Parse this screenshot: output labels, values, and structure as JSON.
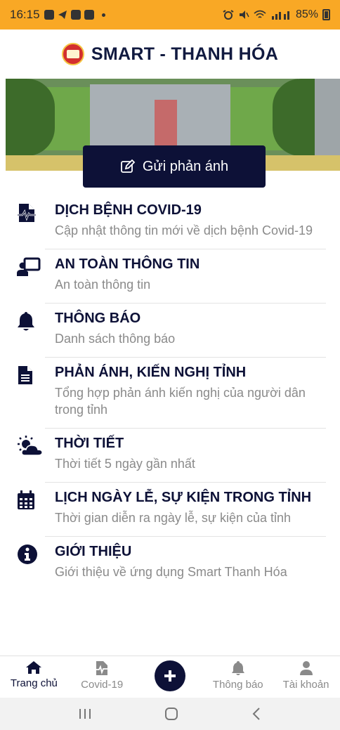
{
  "status_bar": {
    "time": "16:15",
    "battery": "85%"
  },
  "header": {
    "title": "SMART - THANH HÓA"
  },
  "report_button": {
    "label": "Gửi phản ánh"
  },
  "menu": {
    "items": [
      {
        "title": "DỊCH BỆNH COVID-19",
        "subtitle": "Cập nhật thông tin mới về dịch bệnh Covid-19",
        "icon": "covid-report-icon"
      },
      {
        "title": "AN TOÀN THÔNG TIN",
        "subtitle": "An toàn thông tin",
        "icon": "presentation-user-icon"
      },
      {
        "title": "THÔNG BÁO",
        "subtitle": "Danh sách thông báo",
        "icon": "bell-icon"
      },
      {
        "title": "PHẢN ÁNH, KIẾN NGHỊ TỈNH",
        "subtitle": "Tổng hợp phản ánh kiến nghị của người dân trong tỉnh",
        "icon": "document-icon"
      },
      {
        "title": "THỜI TIẾT",
        "subtitle": "Thời tiết 5 ngày gần nhất",
        "icon": "weather-icon"
      },
      {
        "title": "LỊCH NGÀY LỄ, SỰ KIỆN TRONG TỈNH",
        "subtitle": "Thời gian diễn ra ngày lễ, sự kiện của tỉnh",
        "icon": "calendar-icon"
      },
      {
        "title": "GIỚI THIỆU",
        "subtitle": "Giới thiệu về ứng dụng Smart Thanh Hóa",
        "icon": "info-icon"
      }
    ]
  },
  "bottom_nav": {
    "home": "Trang chủ",
    "covid": "Covid-19",
    "notifications": "Thông báo",
    "account": "Tài khoản"
  },
  "colors": {
    "status_bar": "#f9a825",
    "primary": "#0d1137",
    "subtitle": "#8a8a8a"
  }
}
